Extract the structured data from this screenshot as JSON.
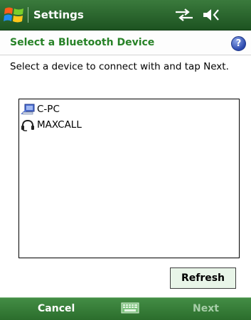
{
  "titlebar": {
    "title": "Settings",
    "icons": [
      "windows-start-icon",
      "connectivity-icon",
      "volume-mute-icon"
    ]
  },
  "header": {
    "title": "Select a Bluetooth Device",
    "help_icon": "help-icon",
    "help_label": "?"
  },
  "instructions": "Select a device to connect with and tap Next.",
  "devices": [
    {
      "name": "C-PC",
      "icon": "computer-icon"
    },
    {
      "name": "MAXCALL",
      "icon": "headset-icon"
    }
  ],
  "refresh_label": "Refresh",
  "softkeys": {
    "left": "Cancel",
    "right": "Next",
    "middle_icon": "keyboard-icon"
  },
  "colors": {
    "title_bar": "#1d5321",
    "header_text": "#278227",
    "refresh_bg": "#e8f5e8",
    "softkey_bar": "#2b6d2c",
    "softkey_disabled": "#a7cea8"
  }
}
